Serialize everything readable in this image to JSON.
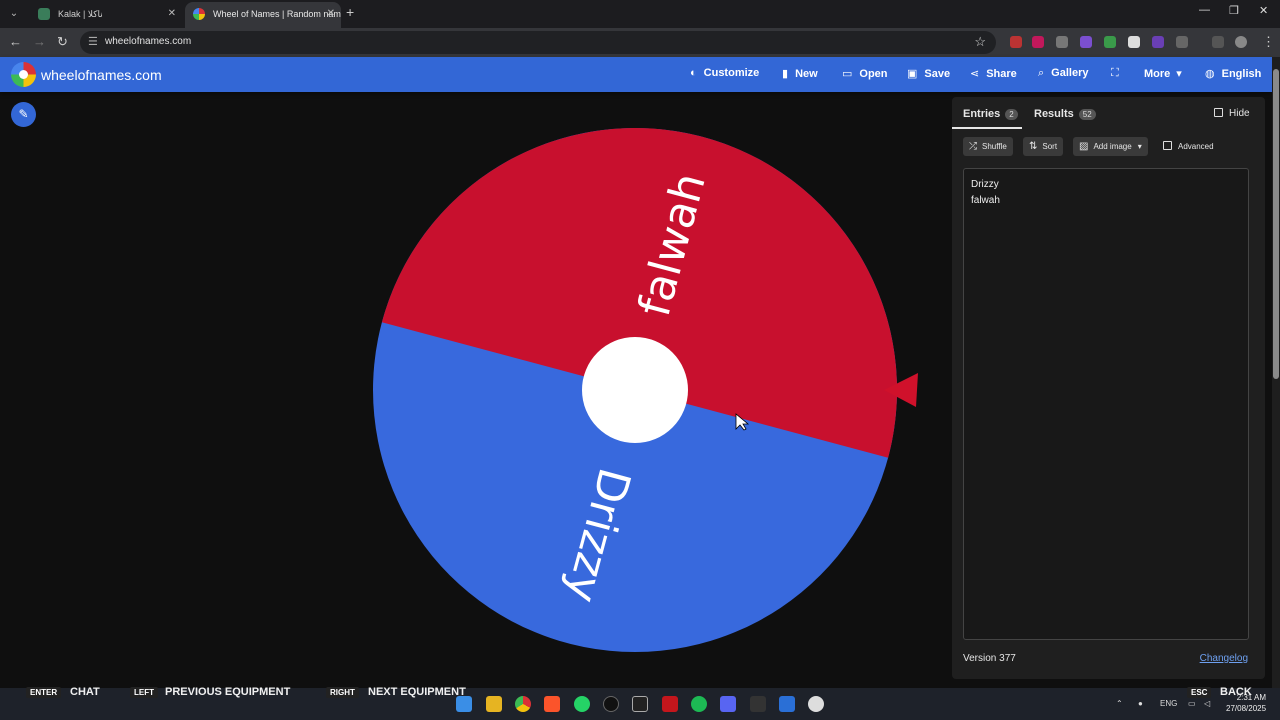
{
  "browser": {
    "tabs": [
      {
        "title": "Kalak | ناكلا",
        "active": false
      },
      {
        "title": "Wheel of Names | Random name picker",
        "active": true
      }
    ],
    "url": "wheelofnames.com"
  },
  "header": {
    "brand": "wheelofnames.com",
    "menu": [
      {
        "label": "Customize",
        "icon": "palette-icon"
      },
      {
        "label": "New",
        "icon": "file-icon"
      },
      {
        "label": "Open",
        "icon": "folder-open-icon"
      },
      {
        "label": "Save",
        "icon": "save-icon"
      },
      {
        "label": "Share",
        "icon": "share-icon"
      },
      {
        "label": "Gallery",
        "icon": "search-icon"
      },
      {
        "label": "",
        "icon": "fullscreen-icon"
      },
      {
        "label": "More",
        "icon": "chevron-down-icon"
      },
      {
        "label": "English",
        "icon": "globe-icon"
      }
    ]
  },
  "wheel": {
    "segments": [
      {
        "label": "falwah",
        "color": "#c8102e"
      },
      {
        "label": "Drizzy",
        "color": "#3869dd"
      }
    ],
    "center_color": "#ffffff",
    "pointer_color": "#d0112b"
  },
  "panel": {
    "tabs": [
      {
        "label": "Entries",
        "count": "2"
      },
      {
        "label": "Results",
        "count": "52"
      }
    ],
    "hide_label": "Hide",
    "buttons": {
      "shuffle": "Shuffle",
      "sort": "Sort",
      "add_image": "Add image"
    },
    "advanced_label": "Advanced",
    "entries": [
      "Drizzy",
      "falwah"
    ],
    "version": "Version 377",
    "changelog": "Changelog"
  },
  "overlay": {
    "hints": [
      {
        "key": "ENTER",
        "label": "CHAT"
      },
      {
        "key": "LEFT",
        "label": "PREVIOUS EQUIPMENT"
      },
      {
        "key": "RIGHT",
        "label": "NEXT EQUIPMENT"
      },
      {
        "key": "ESC",
        "label": "BACK"
      }
    ]
  },
  "taskbar": {
    "lang": "ENG",
    "time": "2:31 AM",
    "date": "27/08/2025"
  },
  "colors": {
    "accent": "#3367d6",
    "panel_bg": "#1f1f1f",
    "page_bg": "#0f0f0f"
  }
}
